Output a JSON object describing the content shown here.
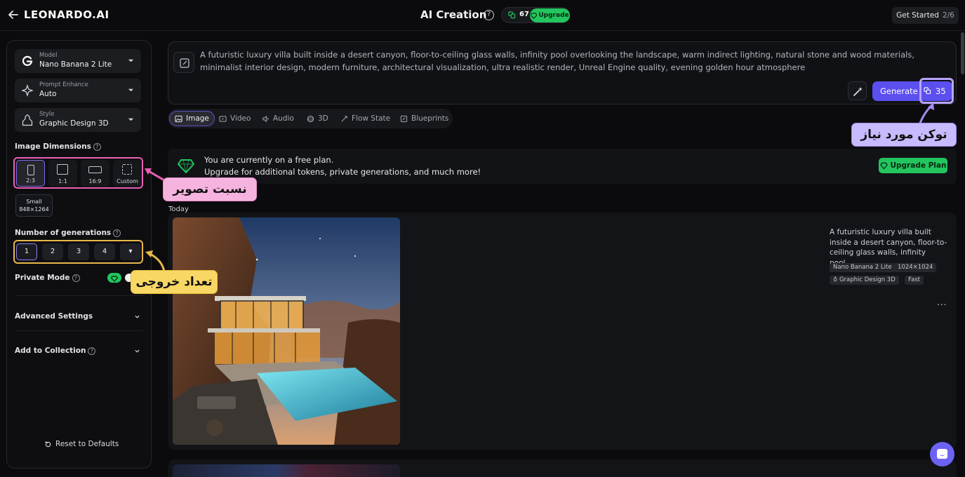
{
  "header": {
    "logo": "LEONARDO.AI",
    "title": "AI Creation",
    "help": "?",
    "token_count": "67",
    "upgrade_label": "Upgrade",
    "get_started_label": "Get Started",
    "get_started_steps": "2/6"
  },
  "sidebar": {
    "model": {
      "label": "Model",
      "value": "Nano Banana 2 Lite"
    },
    "prompt_enhance": {
      "label": "Prompt Enhance",
      "value": "Auto"
    },
    "style": {
      "label": "Style",
      "value": "Graphic Design 3D"
    },
    "image_dimensions": {
      "title": "Image Dimensions",
      "options": [
        "2:3",
        "1:1",
        "16:9",
        "Custom"
      ],
      "selected": "2:3",
      "size_name": "Small",
      "size_value": "848×1264"
    },
    "generations": {
      "title": "Number of generations",
      "options": [
        "1",
        "2",
        "3",
        "4"
      ],
      "selected": "1",
      "more": "▾"
    },
    "private_mode": "Private Mode",
    "advanced_settings": "Advanced Settings",
    "add_to_collection": "Add to Collection",
    "reset": "Reset to Defaults"
  },
  "callouts": {
    "aspect_ratio": "نسبت تصویر",
    "output_count": "تعداد خروجی",
    "required_tokens": "توکن مورد نیاز"
  },
  "prompt": {
    "text": "A futuristic luxury villa built inside a desert canyon, floor-to-ceiling glass walls, infinity pool overlooking the landscape, warm indirect lighting, natural stone and wood materials, minimalist interior design, modern furniture, architectural visualization, ultra realistic render, Unreal Engine quality, evening golden hour atmosphere",
    "generate_label": "Generate",
    "cost": "35"
  },
  "tabs": [
    {
      "label": "Image",
      "icon": "image-icon"
    },
    {
      "label": "Video",
      "icon": "video-icon"
    },
    {
      "label": "Audio",
      "icon": "audio-icon"
    },
    {
      "label": "3D",
      "icon": "cube-icon"
    },
    {
      "label": "Flow State",
      "icon": "flow-icon"
    },
    {
      "label": "Blueprints",
      "icon": "blueprint-icon"
    }
  ],
  "banner": {
    "line1": "You are currently on a free plan.",
    "line2": "Upgrade for additional tokens, private generations, and much more!",
    "upgrade_plan": "Upgrade Plan"
  },
  "feed": {
    "section": "Today",
    "card": {
      "description": "A futuristic luxury villa built inside a desert canyon, floor-to-ceiling glass walls, infinity pool...",
      "tags": [
        "Nano Banana 2 Lite",
        "1024×1024",
        "Graphic Design 3D",
        "Fast"
      ],
      "more": "..."
    }
  },
  "colors": {
    "accent": "#5b4ff0",
    "green": "#22c55e",
    "pink_callout": "#f6b3df",
    "yellow_callout": "#f8d764",
    "purple_callout": "#c9b9ff"
  }
}
